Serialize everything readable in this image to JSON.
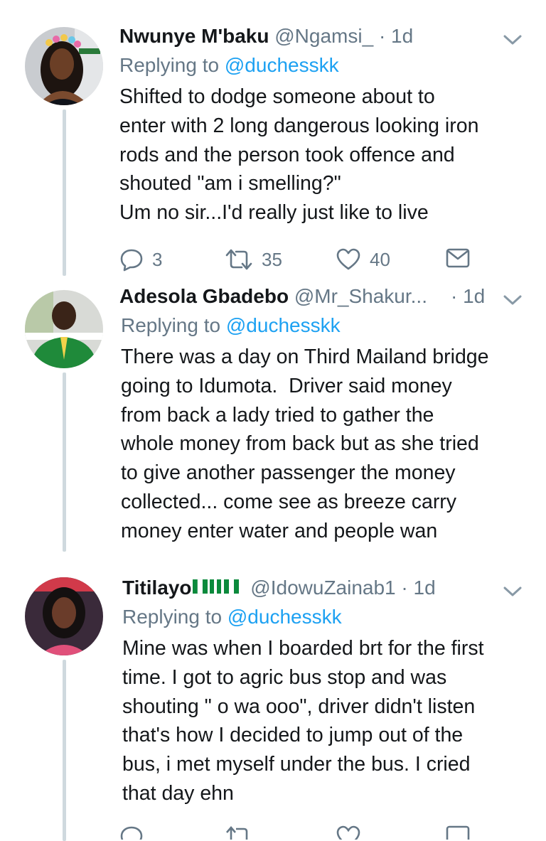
{
  "tweets": [
    {
      "name": "Nwunye M'baku",
      "handle": "@Ngamsi_",
      "dot": "·",
      "time": "1d",
      "replying_prefix": "Replying to ",
      "replying_to": "@duchesskk",
      "text": "Shifted to dodge someone about to\nenter with 2 long dangerous looking iron\nrods and the person took offence and\nshouted \"am i smelling?\"\nUm no sir...I'd really just like to live",
      "replies": "3",
      "retweets": "35",
      "likes": "40"
    },
    {
      "name": "Adesola Gbadebo",
      "handle": "@Mr_Shakur...",
      "dot": "·",
      "time": "1d",
      "replying_prefix": "Replying to ",
      "replying_to": "@duchesskk",
      "text": "There was a day on Third Mailand bridge\ngoing to Idumota.  Driver said money\nfrom back a lady tried to gather the\nwhole money from back but as she tried\nto give another passenger the money\ncollected... come see as breeze carry\nmoney enter water and people wan"
    },
    {
      "name": "Titilayo",
      "handle": "@IdowuZainab1",
      "dot": "·",
      "time": "1d",
      "replying_prefix": "Replying to ",
      "replying_to": "@duchesskk",
      "text": "Mine was when I boarded brt for the first\ntime. I got to agric bus stop and was\nshouting \" o wa ooo\", driver didn't listen\nthat's how I decided to jump out of the\nbus, i met myself under the bus. I cried\nthat day ehn"
    }
  ],
  "icons": [
    "chevron-down-icon",
    "reply-icon",
    "retweet-icon",
    "like-icon",
    "dm-icon",
    "nigeria-flag-icon"
  ],
  "colors": {
    "link": "#1da1f2",
    "secondary": "#657786",
    "text": "#14171a",
    "thread_line": "#cfd9de"
  }
}
